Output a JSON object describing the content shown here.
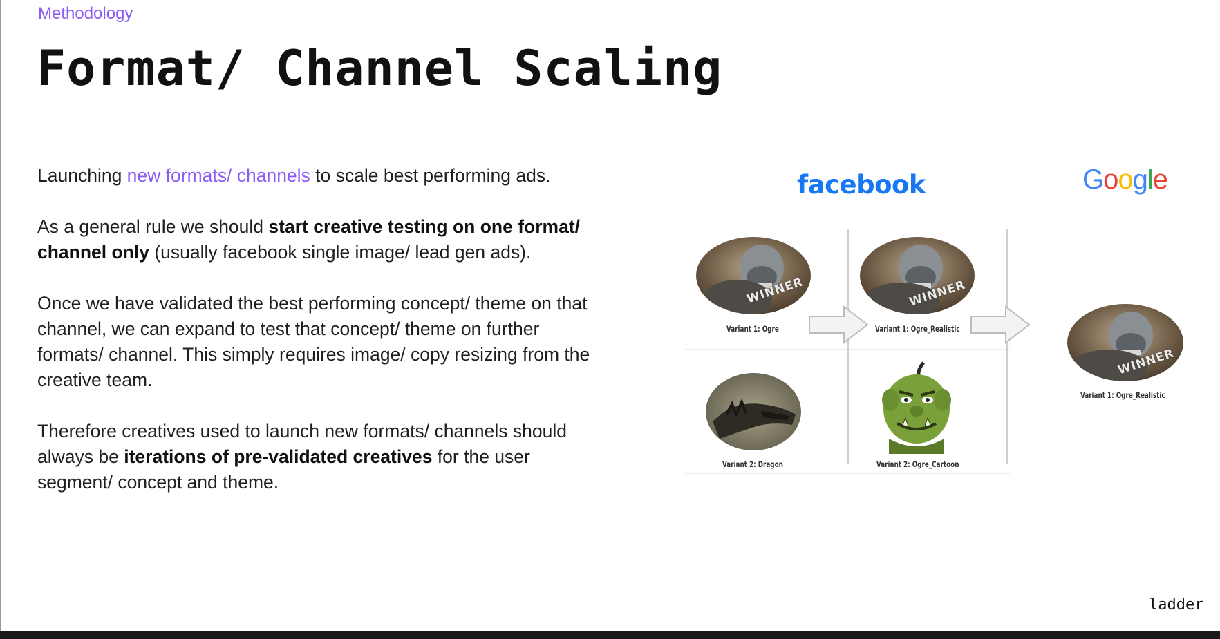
{
  "header": {
    "eyebrow": "Methodology",
    "title": "Format/ Channel Scaling"
  },
  "body": {
    "p1_a": "Launching ",
    "p1_hl": "new formats/ channels",
    "p1_b": " to scale best performing ads.",
    "p2_a": "As a general rule we should ",
    "p2_bold": "start creative testing on one format/ channel only",
    "p2_b": " (usually facebook single image/ lead gen ads).",
    "p3": "Once we have validated the best performing concept/ theme on that channel, we can expand to test that concept/ theme on further formats/ channel. This simply requires image/ copy resizing from the creative team.",
    "p4_a": "Therefore creatives used to launch new formats/ channels should always be ",
    "p4_bold": "iterations of pre-validated creatives",
    "p4_b": " for the user segment/ concept and theme."
  },
  "logos": {
    "facebook": "facebook",
    "google_letters": [
      {
        "ch": "G",
        "color": "#4285F4"
      },
      {
        "ch": "o",
        "color": "#EA4335"
      },
      {
        "ch": "o",
        "color": "#FBBC05"
      },
      {
        "ch": "g",
        "color": "#4285F4"
      },
      {
        "ch": "l",
        "color": "#34A853"
      },
      {
        "ch": "e",
        "color": "#EA4335"
      }
    ]
  },
  "diagram": {
    "winner_label": "WINNER",
    "captions": {
      "c1": "Variant 1: Ogre",
      "c2": "Variant 2: Dragon",
      "c3": "Variant 1: Ogre_Realistic",
      "c4": "Variant 2: Ogre_Cartoon",
      "c5": "Variant 1: Ogre_Realistic"
    }
  },
  "footer": {
    "brand": "ladder"
  }
}
